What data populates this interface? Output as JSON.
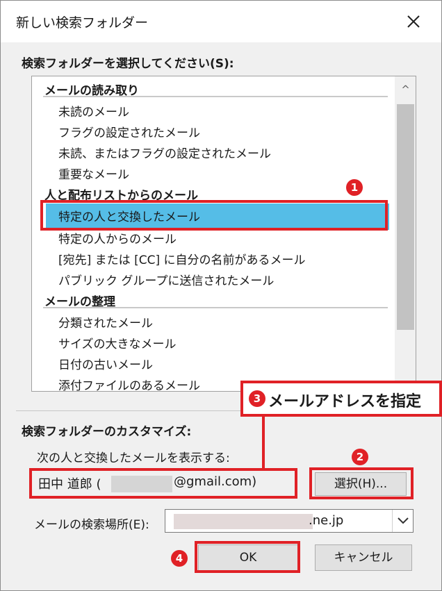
{
  "dialog": {
    "title": "新しい検索フォルダー",
    "choose_label": "検索フォルダーを選択してください(S):",
    "groups": [
      {
        "label": "メールの読み取り",
        "items": [
          "未読のメール",
          "フラグの設定されたメール",
          "未読、またはフラグの設定されたメール",
          "重要なメール"
        ]
      },
      {
        "label": "人と配布リストからのメール",
        "items": [
          "特定の人と交換したメール",
          "特定の人からのメール",
          "[宛先] または [CC] に自分の名前があるメール",
          "パブリック グループに送信されたメール"
        ]
      },
      {
        "label": "メールの整理",
        "items": [
          "分類されたメール",
          "サイズの大きなメール",
          "日付の古いメール",
          "添付ファイルのあるメール"
        ]
      }
    ],
    "selected_item": "特定の人と交換したメール",
    "customize_label": "検索フォルダーのカスタマイズ:",
    "show_label": "次の人と交換したメールを表示する:",
    "person_name": "田中 道郎 (",
    "person_email": "@gmail.com)",
    "select_button": "選択(H)...",
    "location_label": "メールの検索場所(E):",
    "location_value": ".ne.jp",
    "ok_button": "OK",
    "cancel_button": "キャンセル"
  },
  "annotations": {
    "badge_1": "1",
    "badge_2": "2",
    "badge_3": "3",
    "badge_4": "4",
    "callout_text": "メールアドレスを指定"
  },
  "colors": {
    "selection": "#55bde7",
    "annotation_red": "#e02126"
  },
  "icons": [
    "close-icon",
    "scroll-up-icon",
    "dropdown-chevron-icon"
  ]
}
